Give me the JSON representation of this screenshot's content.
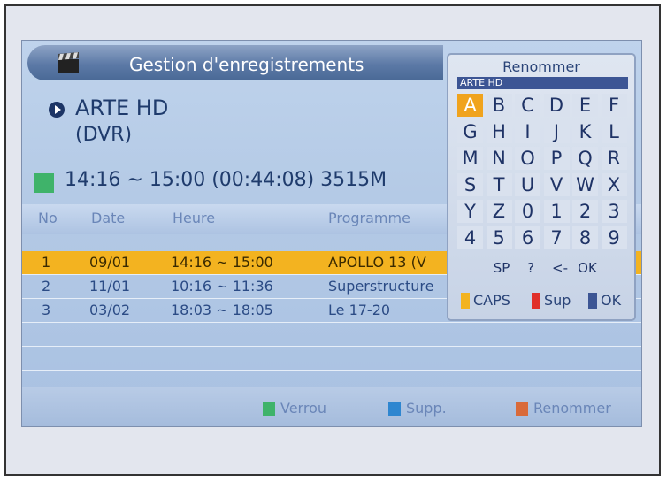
{
  "header": {
    "title": "Gestion d'enregistrements"
  },
  "channel": {
    "name": "ARTE HD",
    "type": "(DVR)"
  },
  "recording_info": "14:16 ~ 15:00 (00:44:08) 3515M",
  "table": {
    "columns": [
      "No",
      "Date",
      "Heure",
      "Programme"
    ],
    "rows": [
      {
        "no": "1",
        "date": "09/01",
        "time": "14:16 ~ 15:00",
        "program": "APOLLO 13 (V",
        "selected": true
      },
      {
        "no": "2",
        "date": "11/01",
        "time": "10:16 ~ 11:36",
        "program": "Superstructure",
        "selected": false
      },
      {
        "no": "3",
        "date": "03/02",
        "time": "18:03 ~ 18:05",
        "program": "Le 17-20",
        "selected": false
      }
    ]
  },
  "footer": {
    "buttons": [
      {
        "label": "Verrou",
        "color": "#3fb36a"
      },
      {
        "label": "Supp.",
        "color": "#2e86d0"
      },
      {
        "label": "Renommer",
        "color": "#d96a3a"
      }
    ]
  },
  "rename_dialog": {
    "title": "Renommer",
    "current_value": "ARTE HD",
    "keys": [
      [
        "A",
        "B",
        "C",
        "D",
        "E",
        "F"
      ],
      [
        "G",
        "H",
        "I",
        "J",
        "K",
        "L"
      ],
      [
        "M",
        "N",
        "O",
        "P",
        "Q",
        "R"
      ],
      [
        "S",
        "T",
        "U",
        "V",
        "W",
        "X"
      ],
      [
        "Y",
        "Z",
        "0",
        "1",
        "2",
        "3"
      ],
      [
        "4",
        "5",
        "6",
        "7",
        "8",
        "9"
      ]
    ],
    "highlighted_key": "A",
    "special_keys": [
      "SP",
      "?",
      "<-",
      "OK"
    ],
    "legend": [
      {
        "label": "CAPS",
        "color": "#f3b320"
      },
      {
        "label": "Sup",
        "color": "#e0302a"
      },
      {
        "label": "OK",
        "color": "#3c5594"
      }
    ]
  }
}
